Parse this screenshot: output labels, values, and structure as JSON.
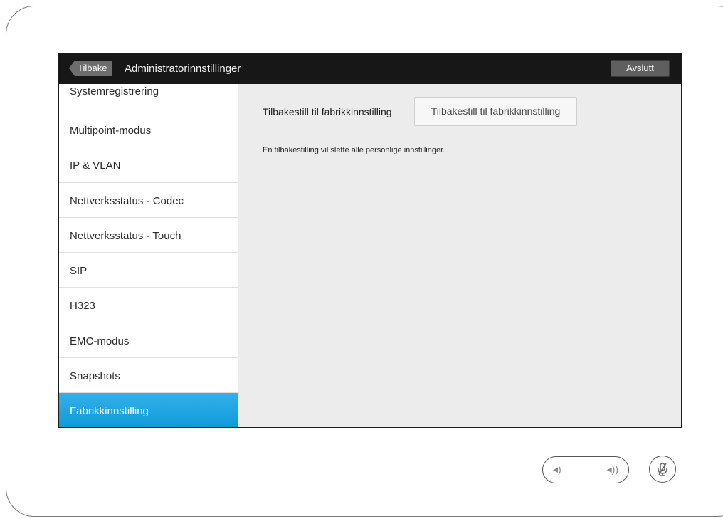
{
  "titlebar": {
    "back_label": "Tilbake",
    "title": "Administratorinnstillinger",
    "exit_label": "Avslutt"
  },
  "sidebar": {
    "items": [
      {
        "label": "Systemregistrering",
        "active": false
      },
      {
        "label": "Multipoint-modus",
        "active": false
      },
      {
        "label": "IP & VLAN",
        "active": false
      },
      {
        "label": "Nettverksstatus - Codec",
        "active": false
      },
      {
        "label": "Nettverksstatus - Touch",
        "active": false
      },
      {
        "label": "SIP",
        "active": false
      },
      {
        "label": "H323",
        "active": false
      },
      {
        "label": "EMC-modus",
        "active": false
      },
      {
        "label": "Snapshots",
        "active": false
      },
      {
        "label": "Fabrikkinnstilling",
        "active": true
      }
    ]
  },
  "content": {
    "reset_label": "Tilbakestill til fabrikkinnstilling",
    "reset_button": "Tilbakestill til fabrikkinnstilling",
    "info": "En tilbakestilling vil slette alle personlige innstillinger."
  },
  "controls": {
    "volume_low_icon": "volume-low-icon",
    "volume_high_icon": "volume-high-icon",
    "mute_icon": "microphone-muted-icon"
  },
  "colors": {
    "accent": "#0e9bd9",
    "titlebar": "#171717"
  }
}
